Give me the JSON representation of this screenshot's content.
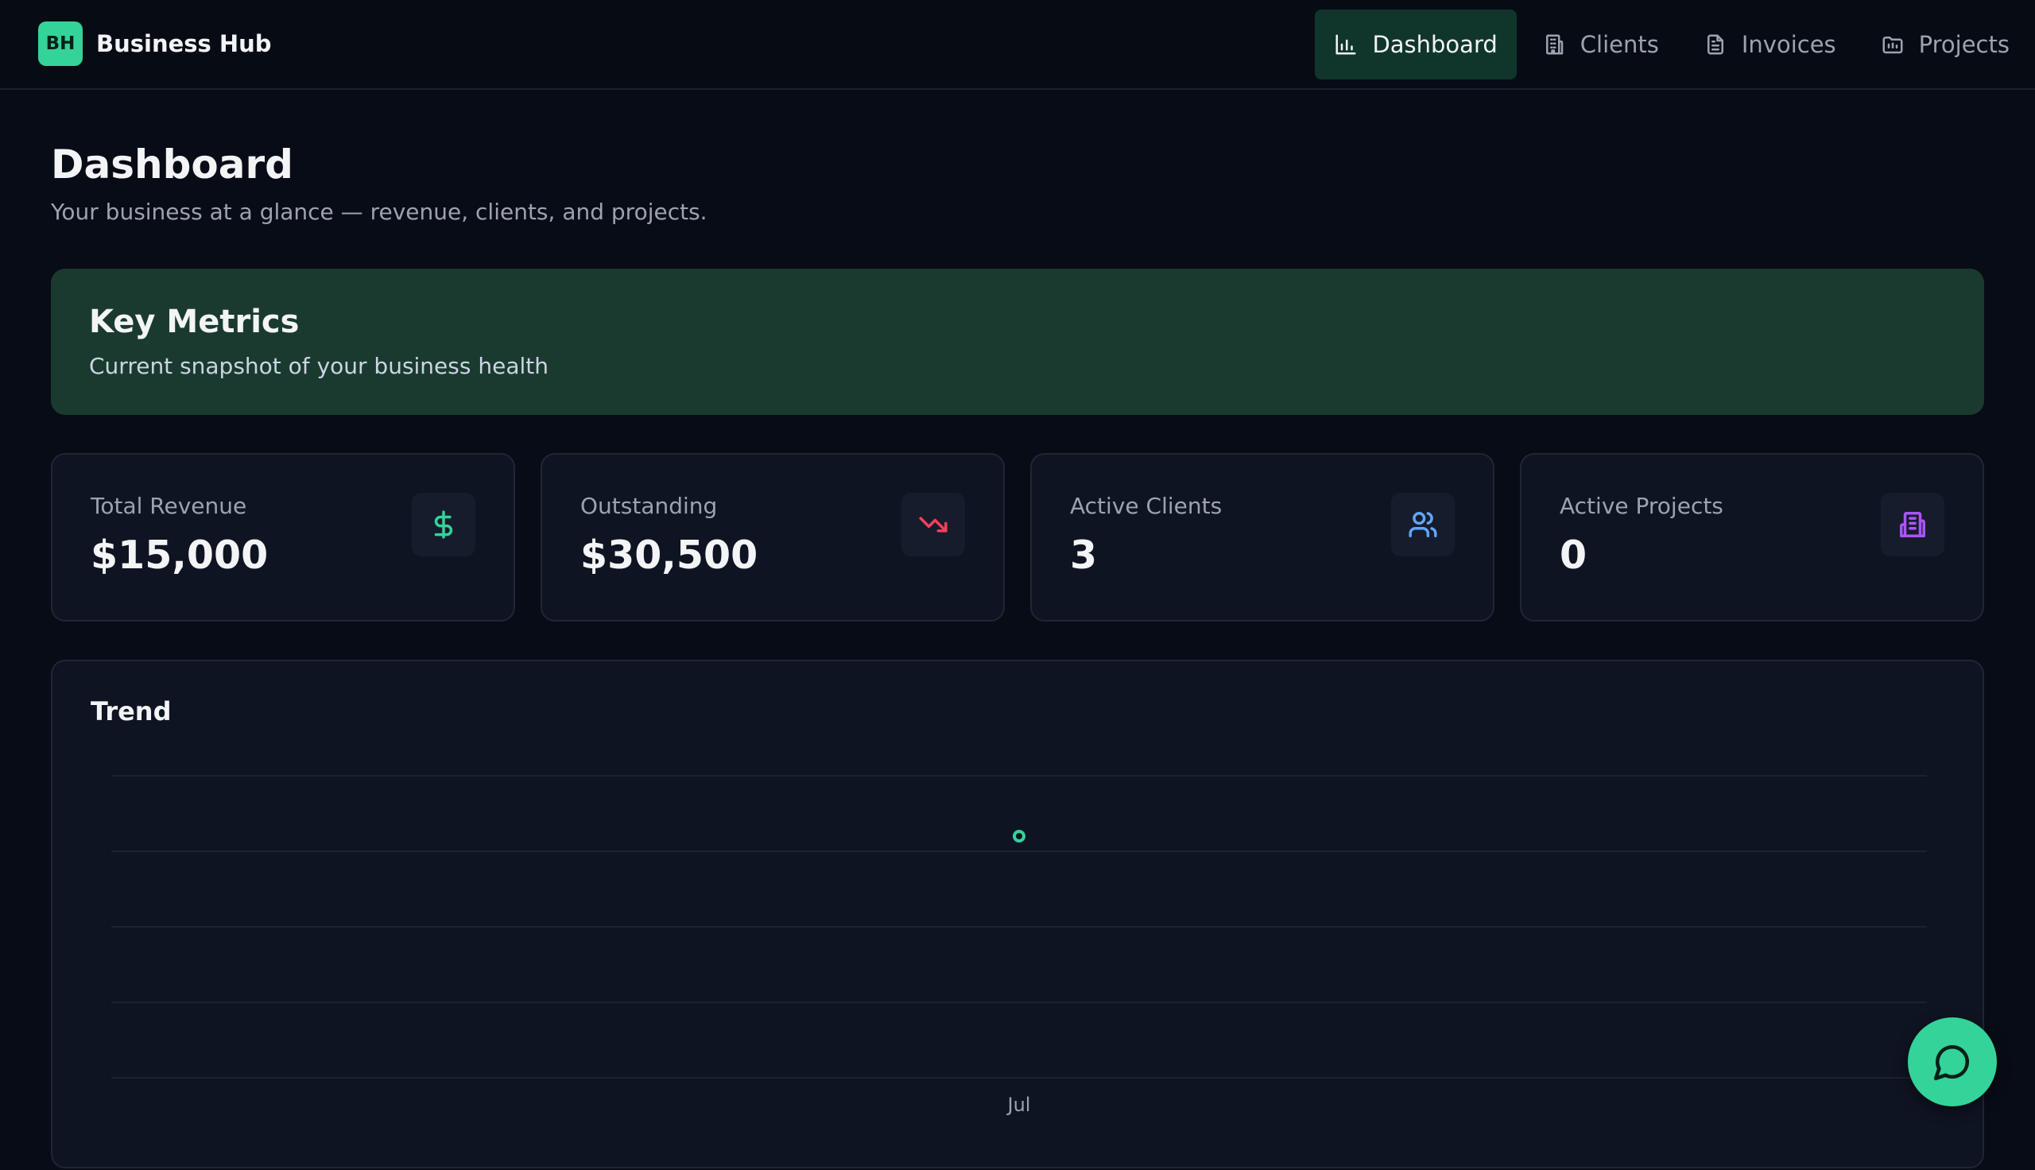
{
  "brand": {
    "logo_text": "BH",
    "name": "Business Hub"
  },
  "nav": [
    {
      "label": "Dashboard",
      "icon": "bar-chart-icon",
      "active": true
    },
    {
      "label": "Clients",
      "icon": "building-icon",
      "active": false
    },
    {
      "label": "Invoices",
      "icon": "document-icon",
      "active": false
    },
    {
      "label": "Projects",
      "icon": "folder-icon",
      "active": false
    }
  ],
  "header": {
    "title": "Dashboard",
    "subtitle": "Your business at a glance — revenue, clients, and projects."
  },
  "banner": {
    "title": "Key Metrics",
    "subtitle": "Current snapshot of your business health"
  },
  "metrics": [
    {
      "label": "Total Revenue",
      "value": "$15,000",
      "icon": "dollar-icon",
      "color": "#34d399"
    },
    {
      "label": "Outstanding",
      "value": "$30,500",
      "icon": "trending-down-icon",
      "color": "#f43f5e"
    },
    {
      "label": "Active Clients",
      "value": "3",
      "icon": "users-icon",
      "color": "#60a5fa"
    },
    {
      "label": "Active Projects",
      "value": "0",
      "icon": "building-icon",
      "color": "#a855f7"
    }
  ],
  "trend": {
    "title": "Trend"
  },
  "chart_data": {
    "type": "line",
    "categories": [
      "Jul"
    ],
    "series": [
      {
        "values": [
          1
        ]
      }
    ],
    "ylim": [
      0,
      1.25
    ],
    "grid": true,
    "color": "#34d399"
  },
  "colors": {
    "accent": "#34d399",
    "background": "#080c16",
    "card": "#0f1422"
  }
}
